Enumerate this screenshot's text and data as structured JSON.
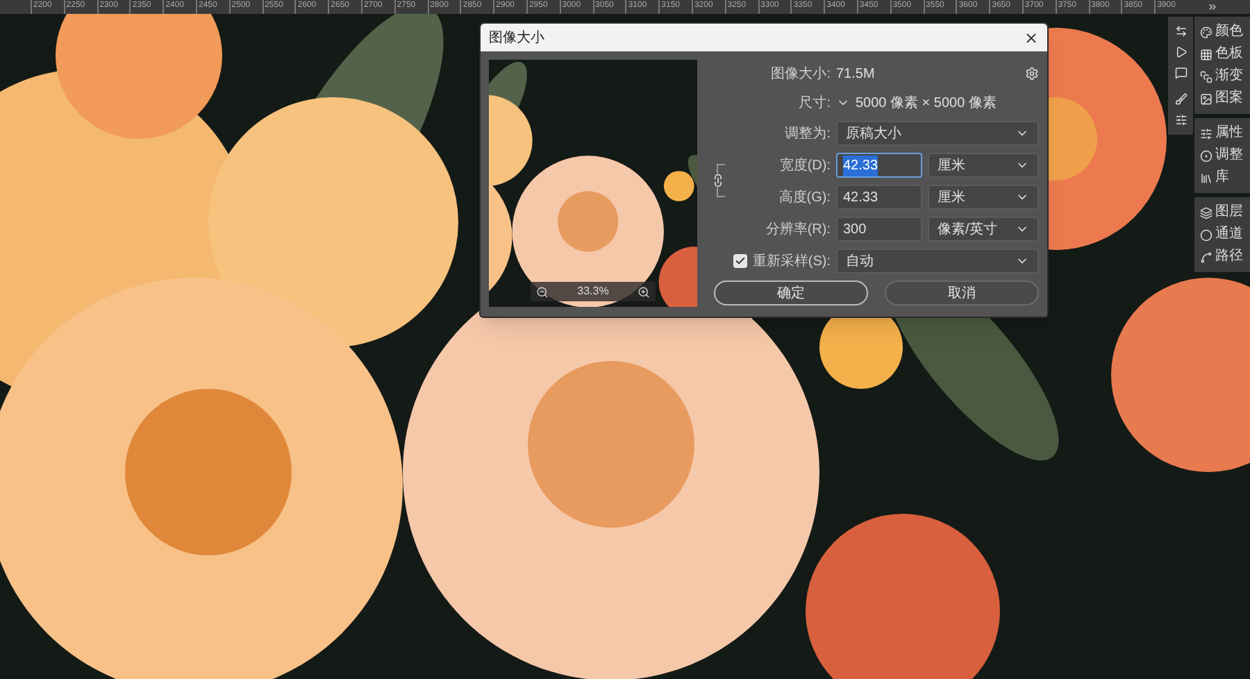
{
  "ruler": {
    "labels": [
      "2200",
      "2250",
      "2300",
      "2350",
      "2400",
      "2450",
      "2500",
      "2550",
      "2600",
      "2650",
      "2700",
      "2750",
      "2800",
      "2850",
      "2900",
      "2950",
      "3000",
      "3050",
      "3100",
      "3150",
      "3200",
      "3250",
      "3300",
      "3350",
      "3400",
      "3450",
      "3500",
      "3550",
      "3600",
      "3650",
      "3700",
      "3750",
      "3800",
      "3850",
      "3900"
    ]
  },
  "dialog": {
    "title": "图像大小",
    "preview": {
      "zoom": "33.3%"
    },
    "image_size": {
      "label": "图像大小:",
      "value": "71.5M"
    },
    "dimensions": {
      "label": "尺寸:",
      "value": "5000 像素 × 5000 像素"
    },
    "fit_to": {
      "label": "调整为:",
      "value": "原稿大小"
    },
    "fields": [
      {
        "label": "宽度(D):",
        "value": "42.33",
        "unit": "厘米",
        "selected": true
      },
      {
        "label": "高度(G):",
        "value": "42.33",
        "unit": "厘米",
        "selected": false
      },
      {
        "label": "分辨率(R):",
        "value": "300",
        "unit": "像素/英寸",
        "selected": false
      }
    ],
    "resample": {
      "label": "重新采样(S):",
      "checked": true,
      "value": "自动"
    },
    "buttons": [
      {
        "label": "确定",
        "kind": "primary"
      },
      {
        "label": "取消",
        "kind": "secondary"
      }
    ]
  },
  "panels": [
    {
      "items": [
        {
          "label": "颜色"
        },
        {
          "label": "色板"
        },
        {
          "label": "渐变"
        },
        {
          "label": "图案"
        }
      ]
    },
    {
      "items": [
        {
          "label": "属性"
        },
        {
          "label": "调整"
        },
        {
          "label": "库"
        }
      ]
    },
    {
      "items": [
        {
          "label": "图层"
        },
        {
          "label": "通道"
        },
        {
          "label": "路径"
        }
      ]
    }
  ]
}
